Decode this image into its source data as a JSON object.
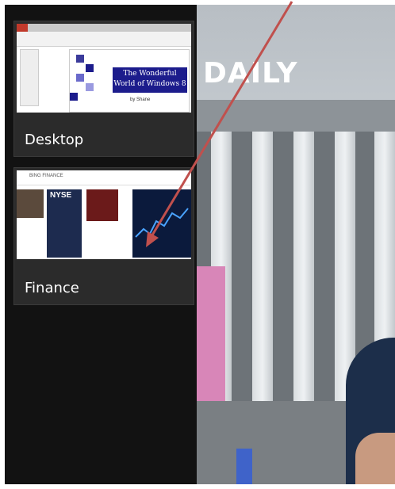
{
  "switcher": {
    "items": [
      {
        "label": "Desktop"
      },
      {
        "label": "Finance"
      }
    ]
  },
  "desktop_thumb": {
    "slide_title": "The Wonderful World of Windows 8",
    "slide_subtitle": "by Shane"
  },
  "finance_thumb": {
    "header": "BING FINANCE",
    "tile2_text": "NYSE"
  },
  "wallpaper": {
    "headline": "DAILY"
  },
  "colors": {
    "rail_bg": "#121212",
    "card_bg": "#2b2b2b",
    "arrow": "#c0504d"
  }
}
